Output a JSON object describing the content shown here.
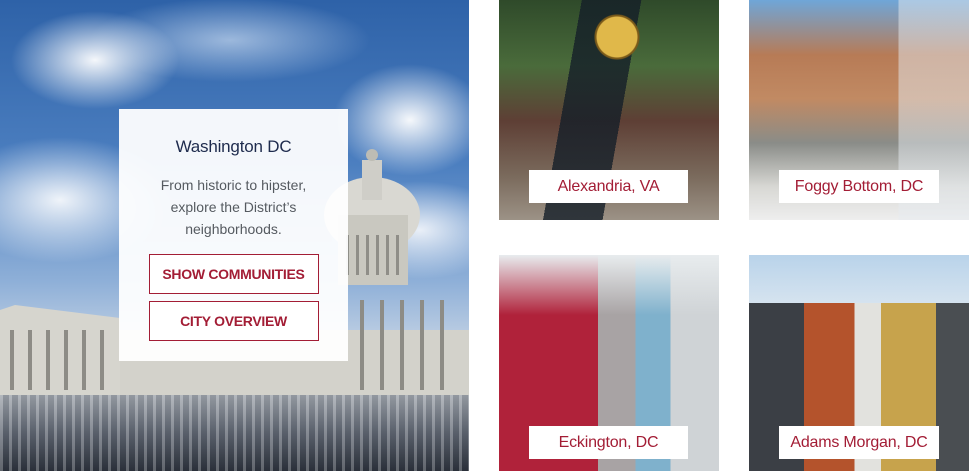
{
  "hero": {
    "title": "Washington DC",
    "description": "From historic to hipster, explore the District’s neighborhoods.",
    "buttons": {
      "show_communities": "SHOW COMMUNITIES",
      "city_overview": "CITY OVERVIEW"
    }
  },
  "neighborhoods": [
    {
      "name": "Alexandria, VA"
    },
    {
      "name": "Foggy Bottom, DC"
    },
    {
      "name": "Eckington, DC"
    },
    {
      "name": "Adams Morgan, DC"
    }
  ],
  "colors": {
    "accent": "#a31d35",
    "title": "#1e2b4d",
    "text": "#555a60"
  }
}
